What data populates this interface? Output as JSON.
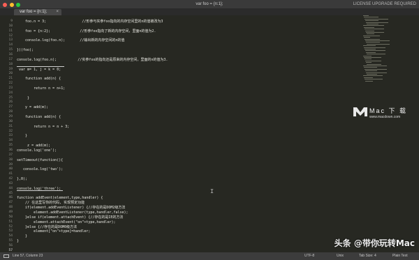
{
  "window": {
    "title": "var foo = {n:1};",
    "license": "LICENSE UPGRADE REQUIRED",
    "colors": {
      "close": "#ff5f56",
      "minimize": "#ffbd2e",
      "zoom": "#27c93f"
    }
  },
  "tab": {
    "label": "var foo = {n:1};",
    "close": "×"
  },
  "editor": {
    "current_line": 57,
    "lines": [
      {
        "n": 9,
        "text": "    foo.n = 3;                 //形参与实参foo指向的内存空间里的n的值被改为3"
      },
      {
        "n": 10,
        "text": ""
      },
      {
        "n": 11,
        "text": "    foo = {n:2};              //形参foo指向了新的内存空间，里面n的值为2."
      },
      {
        "n": 12,
        "text": ""
      },
      {
        "n": 13,
        "text": "    console.log(foo.n);       //输出新的内存空间的n的值"
      },
      {
        "n": 14,
        "text": ""
      },
      {
        "n": 15,
        "text": "})(foo);"
      },
      {
        "n": 16,
        "text": ""
      },
      {
        "n": 17,
        "text": "console.log(foo.n);          //实参foo的指向还是原来的内存空间，里面的n的值为3."
      },
      {
        "n": 18,
        "text": ""
      },
      {
        "n": 19,
        "text": " var m= 1, j = k = 0;"
      },
      {
        "n": 20,
        "text": ""
      },
      {
        "n": 21,
        "text": "    function add(n) {"
      },
      {
        "n": 22,
        "text": ""
      },
      {
        "n": 23,
        "text": "        return n = n+1;"
      },
      {
        "n": 24,
        "text": ""
      },
      {
        "n": 25,
        "text": "     }"
      },
      {
        "n": 26,
        "text": ""
      },
      {
        "n": 27,
        "text": "    y = add(m);"
      },
      {
        "n": 28,
        "text": ""
      },
      {
        "n": 29,
        "text": "    function add(n) {"
      },
      {
        "n": 30,
        "text": ""
      },
      {
        "n": 31,
        "text": "        return n = n + 3;"
      },
      {
        "n": 32,
        "text": ""
      },
      {
        "n": 33,
        "text": "    }"
      },
      {
        "n": 34,
        "text": ""
      },
      {
        "n": 35,
        "text": "     z = add(m);"
      },
      {
        "n": 36,
        "text": "console.log('one');"
      },
      {
        "n": 37,
        "text": ""
      },
      {
        "n": 38,
        "text": "setTimeout(function(){"
      },
      {
        "n": 39,
        "text": ""
      },
      {
        "n": 40,
        "text": "   console.log('two');"
      },
      {
        "n": 41,
        "text": ""
      },
      {
        "n": 42,
        "text": "},0);"
      },
      {
        "n": 43,
        "text": ""
      },
      {
        "n": 44,
        "text": "console.log('three');"
      },
      {
        "n": 45,
        "text": ""
      },
      {
        "n": 46,
        "text": "function addEvent(element,type,handler) {"
      },
      {
        "n": 47,
        "text": "    // 在这里写你的代码, 实现预定功能"
      },
      {
        "n": 48,
        "text": "    if(element.addEventListener) {//存在的是DOM2级方法"
      },
      {
        "n": 49,
        "text": "        element.addEventListener(type,handler,false);"
      },
      {
        "n": 50,
        "text": "    }else if(element.attachEvent) {//存在的是IE的方法"
      },
      {
        "n": 51,
        "text": "        element.attachEvent(\"on\"+type,handler);"
      },
      {
        "n": 52,
        "text": "    }else {//存在的是DOM0级方法"
      },
      {
        "n": 53,
        "text": "        element[\"on\"+type]=handler;"
      },
      {
        "n": 54,
        "text": "    }"
      },
      {
        "n": 55,
        "text": "}"
      },
      {
        "n": 56,
        "text": ""
      },
      {
        "n": 57,
        "text": ""
      }
    ]
  },
  "watermark": {
    "brand": "Mac 下 载",
    "url": "www.macdown.com"
  },
  "statusbar": {
    "position": "Line 57, Column 23",
    "encoding": "UTF-8",
    "line_endings": "Unix",
    "tab_size": "Tab Size: 4",
    "syntax": "Plain Text"
  },
  "overlay": {
    "text": "头条 @带你玩转Mac"
  }
}
